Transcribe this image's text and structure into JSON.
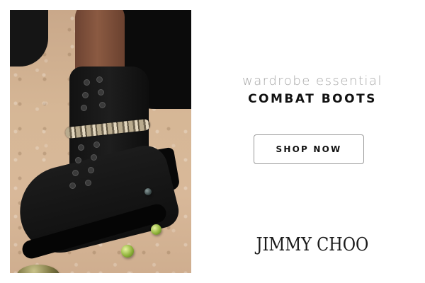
{
  "ad": {
    "tagline": "wardrobe essential",
    "headline": "COMBAT BOOTS",
    "cta_label": "SHOP NOW",
    "brand_logo": "JIMMY CHOO"
  },
  "image": {
    "subject": "boot-photo"
  },
  "colors": {
    "tagline": "#a8a8a8",
    "headline": "#111111",
    "button_border": "#9a9a9a",
    "background": "#ffffff"
  }
}
